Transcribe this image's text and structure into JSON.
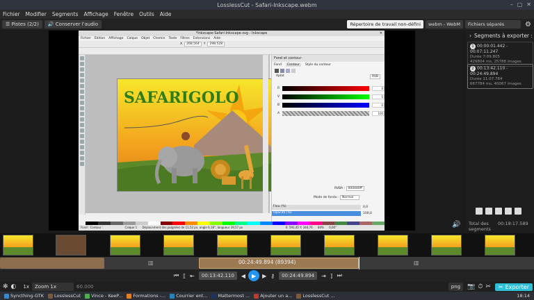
{
  "window": {
    "title": "LosslessCut - Safari-Inkscape.webm"
  },
  "menu": [
    "Fichier",
    "Modifier",
    "Segments",
    "Affichage",
    "Fenêtre",
    "Outils",
    "Aide"
  ],
  "topbar": {
    "tracks_label": "Pistes (2/2)",
    "keep_audio_label": "Conserver l'audio",
    "workdir_label": "Répertoire de travail non-défini",
    "format_value": "webm - WebM",
    "output_mode_value": "Fichiers séparés"
  },
  "inkscape": {
    "title": "*Inkscape-Safari-Inkscape.svg - Inkscape",
    "menu": [
      "Fichier",
      "Édition",
      "Affichage",
      "Calque",
      "Objet",
      "Chemin",
      "Texte",
      "Filtres",
      "Extensions",
      "Aide"
    ],
    "toolbar": {
      "x_label": "X",
      "x_value": "268,564",
      "y_label": "Y",
      "y_value": "298,528"
    },
    "art_title": "SAFARIGOLO",
    "panel": {
      "title": "Fond et contour",
      "tabs": [
        "Fond",
        "Contour",
        "Style du contour"
      ],
      "flat_label": "Aplat",
      "mode_value": "RVB",
      "channels": [
        {
          "label": "R",
          "value": "0"
        },
        {
          "label": "V",
          "value": "0"
        },
        {
          "label": "B",
          "value": "0"
        },
        {
          "label": "A",
          "value": "100"
        }
      ],
      "rgba_label": "RVBA :",
      "rgba_value": "000000ff",
      "blend_label": "Mode de fondu :",
      "blend_value": "Normal",
      "blur_label": "Flou (%)",
      "blur_value": "0,0",
      "opacity_label": "Opacité (%)",
      "opacity_value": "100,0"
    },
    "status": {
      "fill_label": "Fond :",
      "stroke_label": "Contour :",
      "layer": "Calque 1",
      "message": "Déplacement des poignées de 11,52 px, angle 6,18°, longueur 39,57 px",
      "x": "X: 591,45",
      "y": "Y: 344,76",
      "zoom": "84%",
      "rot": "0,00°"
    }
  },
  "segments": {
    "header": "Segments à exporter :",
    "items": [
      {
        "num": "1",
        "range": "00:00:01.442 - 00:07:11.247",
        "duration": "Durée 7:09.805",
        "info": "429804 ms, 25788 images"
      },
      {
        "num": "2",
        "range": "00:13:42.110 - 00:24:49.894",
        "duration": "Durée 11:07.784",
        "info": "667784 ms, 40067 images"
      }
    ],
    "total_label": "Total des segments :",
    "total_value": "00:18:17.589"
  },
  "timeline": {
    "current_time": "00:24:49.894 (89394)"
  },
  "controls": {
    "start_time": "00:13:42.110",
    "end_time": "00:24:49.894"
  },
  "bottom": {
    "speed": "1x",
    "zoom_label": "Zoom 1x",
    "zoom_value": "60.000",
    "format": "png",
    "export_label": "Exporter"
  },
  "taskbar": {
    "items": [
      "Syncthing-GTK",
      "LosslessCut",
      "Vince - KeeP...",
      "Formations -...",
      "Courrier ent...",
      "Mattermost ...",
      "Ajouter un a...",
      "LosslessCut ..."
    ],
    "clock": "18:14"
  },
  "colors": {
    "accent": "#2196f3",
    "segment": "#8c6e4e",
    "export": "#2dbfd6"
  }
}
